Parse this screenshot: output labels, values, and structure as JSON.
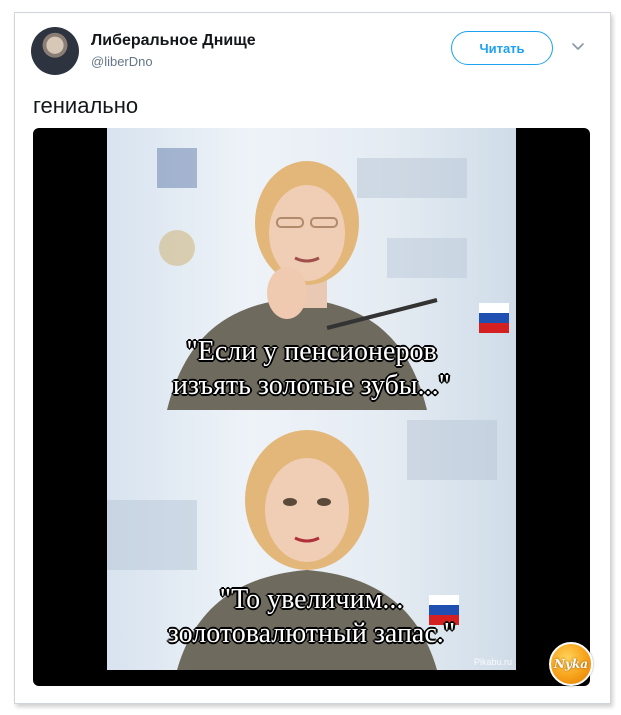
{
  "tweet": {
    "author": {
      "name": "Либеральное Днище",
      "handle": "@liberDno"
    },
    "follow_label": "Читать",
    "text": "гениально"
  },
  "media": {
    "caption_top": [
      "\"Если у пенсионеров",
      "изъять золотые зубы...\""
    ],
    "caption_bottom": [
      "\"То увеличим...",
      "золотовалютный запас.\""
    ],
    "watermark": "Pikabu.ru"
  },
  "logo": {
    "text": "Nyka"
  },
  "colors": {
    "accent": "#1da1f2",
    "name_text": "#14171a",
    "handle_text": "#657786",
    "media_background": "#000000"
  },
  "icons": {
    "menu": "chevron-down-icon",
    "avatar": "avatar"
  }
}
